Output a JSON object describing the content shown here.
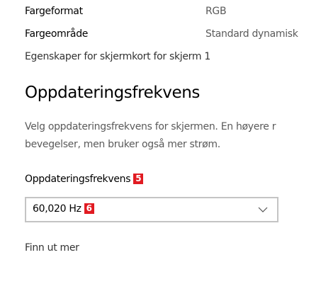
{
  "properties": [
    {
      "label": "Fargeformat",
      "value": "RGB"
    },
    {
      "label": "Fargeområde",
      "value": "Standard dynamisk"
    }
  ],
  "adapter_link": "Egenskaper for skjermkort for skjerm 1",
  "refresh_section": {
    "title": "Oppdateringsfrekvens",
    "description_line1": "Velg oppdateringsfrekvens for skjermen. En høyere r",
    "description_line2": "bevegelser, men bruker også mer strøm.",
    "field_label": "Oppdateringsfrekvens",
    "label_badge": "5",
    "selected_value": "60,020 Hz",
    "value_badge": "6",
    "learn_more": "Finn ut mer"
  },
  "colors": {
    "badge": "#e11b22",
    "dropdown_border": "#c4c4c4"
  }
}
